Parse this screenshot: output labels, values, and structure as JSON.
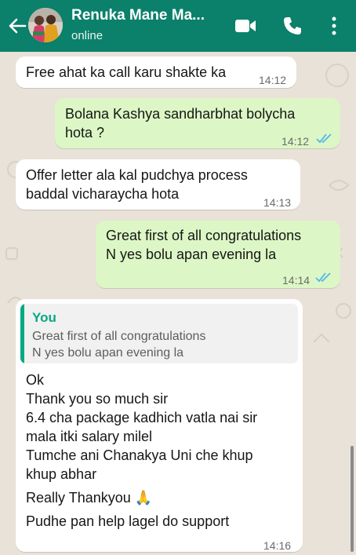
{
  "header": {
    "contact_name": "Renuka Mane Ma...",
    "status": "online",
    "icons": [
      "back-arrow-icon",
      "avatar",
      "video-call-icon",
      "voice-call-icon",
      "more-options-icon"
    ],
    "color": "#0b806b"
  },
  "messages": [
    {
      "direction": "incoming",
      "text": "Free ahat ka call karu shakte ka",
      "time": "14:12"
    },
    {
      "direction": "outgoing",
      "lines": [
        "Bolana Kashya sandharbhat bolycha",
        "hota ?"
      ],
      "time": "14:12",
      "status": "read"
    },
    {
      "direction": "incoming",
      "lines": [
        "Offer letter  ala kal pudchya process",
        "baddal vicharaycha hota"
      ],
      "time": "14:13"
    },
    {
      "direction": "outgoing",
      "lines": [
        "Great first of all congratulations",
        "N yes bolu apan evening la"
      ],
      "time": "14:14",
      "status": "read"
    },
    {
      "direction": "incoming",
      "reply_to": {
        "author": "You",
        "lines": [
          "Great first of all congratulations",
          "N yes bolu apan evening la"
        ]
      },
      "lines": [
        "Ok",
        "Thank you  so much sir",
        "6.4 cha package kadhich vatla nai sir",
        "mala itki salary milel",
        "Tumche ani Chanakya Uni che khup",
        "khup abhar",
        "Really  Thankyou 🙏",
        "Pudhe pan help lagel do support"
      ],
      "time": "14:16"
    }
  ],
  "colors": {
    "incoming_bubble": "#ffffff",
    "outgoing_bubble": "#dcf7c5",
    "read_ticks": "#4fb6ec",
    "quote_accent": "#08a884",
    "wallpaper": "#e9e2d8"
  }
}
